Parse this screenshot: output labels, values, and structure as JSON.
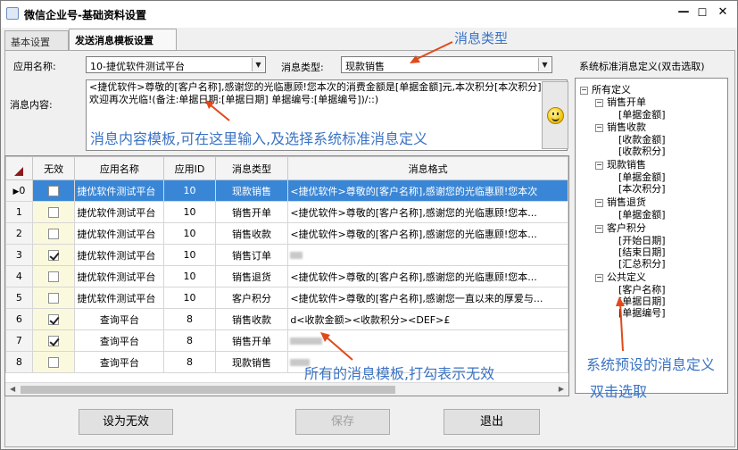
{
  "window": {
    "title": "微信企业号-基础资料设置",
    "minimize": "—",
    "maximize": "☐",
    "close": "✕"
  },
  "tabs": [
    "基本设置",
    "发送消息模板设置"
  ],
  "form": {
    "app_label": "应用名称:",
    "app_value": "10-捷优软件测试平台",
    "type_label": "消息类型:",
    "type_value": "现款销售",
    "content_label": "消息内容:",
    "content_value": "<捷优软件>尊敬的[客户名称],感谢您的光临惠顾!您本次的消费金额是[单据金额]元,本次积分[本次积分]分,欢迎再次光临!(备注:单据日期:[单据日期] 单据编号:[单据编号])/::)"
  },
  "grid": {
    "columns": [
      "无效",
      "应用名称",
      "应用ID",
      "消息类型",
      "消息格式"
    ],
    "rows": [
      {
        "idx": "0",
        "invalid": false,
        "app": "捷优软件测试平台",
        "id": "10",
        "type": "现款销售",
        "format": "<捷优软件>尊敬的[客户名称],感谢您的光临惠顾!您本次",
        "selected": true
      },
      {
        "idx": "1",
        "invalid": false,
        "app": "捷优软件测试平台",
        "id": "10",
        "type": "销售开单",
        "format": "<捷优软件>尊敬的[客户名称],感谢您的光临惠顾!您本..."
      },
      {
        "idx": "2",
        "invalid": false,
        "app": "捷优软件测试平台",
        "id": "10",
        "type": "销售收款",
        "format": "<捷优软件>尊敬的[客户名称],感谢您的光临惠顾!您本..."
      },
      {
        "idx": "3",
        "invalid": true,
        "app": "捷优软件测试平台",
        "id": "10",
        "type": "销售订单",
        "format": ""
      },
      {
        "idx": "4",
        "invalid": false,
        "app": "捷优软件测试平台",
        "id": "10",
        "type": "销售退货",
        "format": "<捷优软件>尊敬的[客户名称],感谢您的光临惠顾!您本..."
      },
      {
        "idx": "5",
        "invalid": false,
        "app": "捷优软件测试平台",
        "id": "10",
        "type": "客户积分",
        "format": "<捷优软件>尊敬的[客户名称],感谢您一直以来的厚爱与..."
      },
      {
        "idx": "6",
        "invalid": true,
        "app": "查询平台",
        "id": "8",
        "type": "销售收款",
        "format": "d<收款金额><收款积分><DEF>£"
      },
      {
        "idx": "7",
        "invalid": true,
        "app": "查询平台",
        "id": "8",
        "type": "销售开单",
        "format": ""
      },
      {
        "idx": "8",
        "invalid": false,
        "app": "查询平台",
        "id": "8",
        "type": "现款销售",
        "format": ""
      }
    ]
  },
  "tree": {
    "title": "系统标准消息定义(双击选取)",
    "root": "所有定义",
    "groups": [
      {
        "name": "销售开单",
        "items": [
          "[单据金额]"
        ]
      },
      {
        "name": "销售收款",
        "items": [
          "[收款金额]",
          "[收款积分]"
        ]
      },
      {
        "name": "现款销售",
        "items": [
          "[单据金额]",
          "[本次积分]"
        ]
      },
      {
        "name": "销售退货",
        "items": [
          "[单据金额]"
        ]
      },
      {
        "name": "客户积分",
        "items": [
          "[开始日期]",
          "[结束日期]",
          "[汇总积分]"
        ]
      },
      {
        "name": "公共定义",
        "items": [
          "[客户名称]",
          "[单据日期]",
          "[单据编号]"
        ]
      }
    ]
  },
  "buttons": {
    "invalid": "设为无效",
    "save": "保存",
    "exit": "退出"
  },
  "annotations": {
    "type": "消息类型",
    "content": "消息内容模板,可在这里输入,及选择系统标准消息定义",
    "templates": "所有的消息模板,打勾表示无效",
    "system1": "系统预设的消息定义",
    "system2": "双击选取"
  },
  "colors": {
    "selection": "#3a86d6",
    "annotation_text": "#3a73c4",
    "annotation_arrow": "#e04a1a",
    "invalid_column": "#fbf9dd"
  }
}
